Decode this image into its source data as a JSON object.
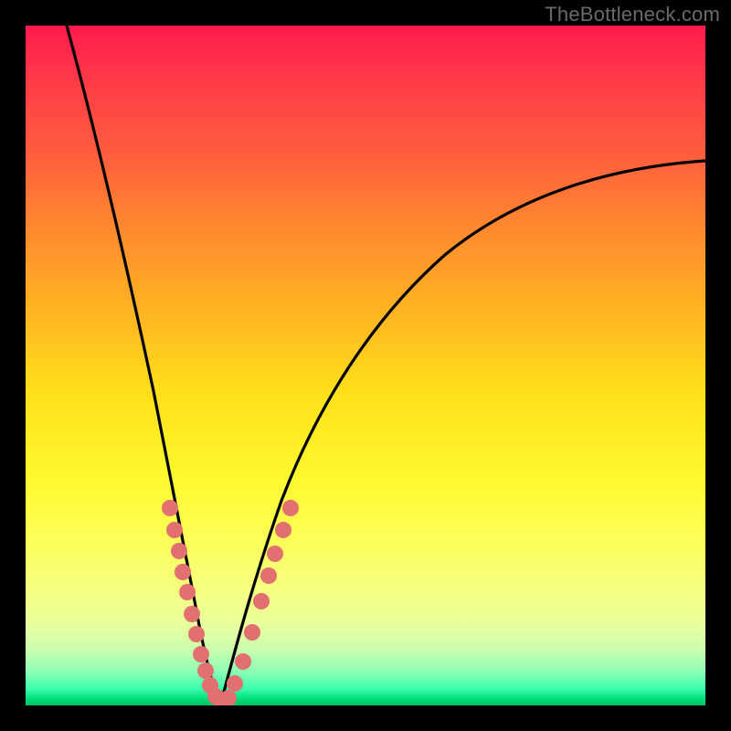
{
  "watermark": "TheBottleneck.com",
  "chart_data": {
    "type": "line",
    "title": "",
    "xlabel": "",
    "ylabel": "",
    "xlim": [
      0,
      100
    ],
    "ylim": [
      0,
      100
    ],
    "grid": false,
    "legend": false,
    "background": {
      "type": "vertical-gradient",
      "description": "red at top through orange and yellow to green at bottom; color encodes bottleneck severity (top high, bottom low)"
    },
    "series": [
      {
        "name": "left-branch",
        "color": "#000000",
        "x": [
          6,
          10,
          14,
          17,
          20,
          22,
          23.5,
          25,
          26.5,
          28
        ],
        "y": [
          100,
          80,
          60,
          45,
          30,
          20,
          12,
          6,
          2,
          0
        ]
      },
      {
        "name": "right-branch",
        "color": "#000000",
        "x": [
          28,
          30,
          33,
          37,
          42,
          50,
          60,
          72,
          86,
          100
        ],
        "y": [
          0,
          5,
          15,
          28,
          40,
          52,
          62,
          70,
          76,
          80
        ]
      },
      {
        "name": "markers-left",
        "type": "scatter",
        "color": "#e27070",
        "x": [
          20.5,
          21.3,
          21.8,
          22.5,
          23.0,
          23.8,
          24.3,
          25.0,
          25.8,
          26.5,
          27.3,
          28.0
        ],
        "y": [
          28,
          25,
          22,
          19,
          16,
          13,
          10,
          7,
          5,
          3,
          1.5,
          0.5
        ]
      },
      {
        "name": "markers-right",
        "type": "scatter",
        "color": "#e27070",
        "x": [
          28.7,
          29.5,
          30.5,
          31.8,
          33.2,
          34.0,
          34.8,
          36.0,
          37.0
        ],
        "y": [
          1,
          3,
          7,
          12,
          18,
          22,
          26,
          30,
          32
        ]
      }
    ]
  }
}
